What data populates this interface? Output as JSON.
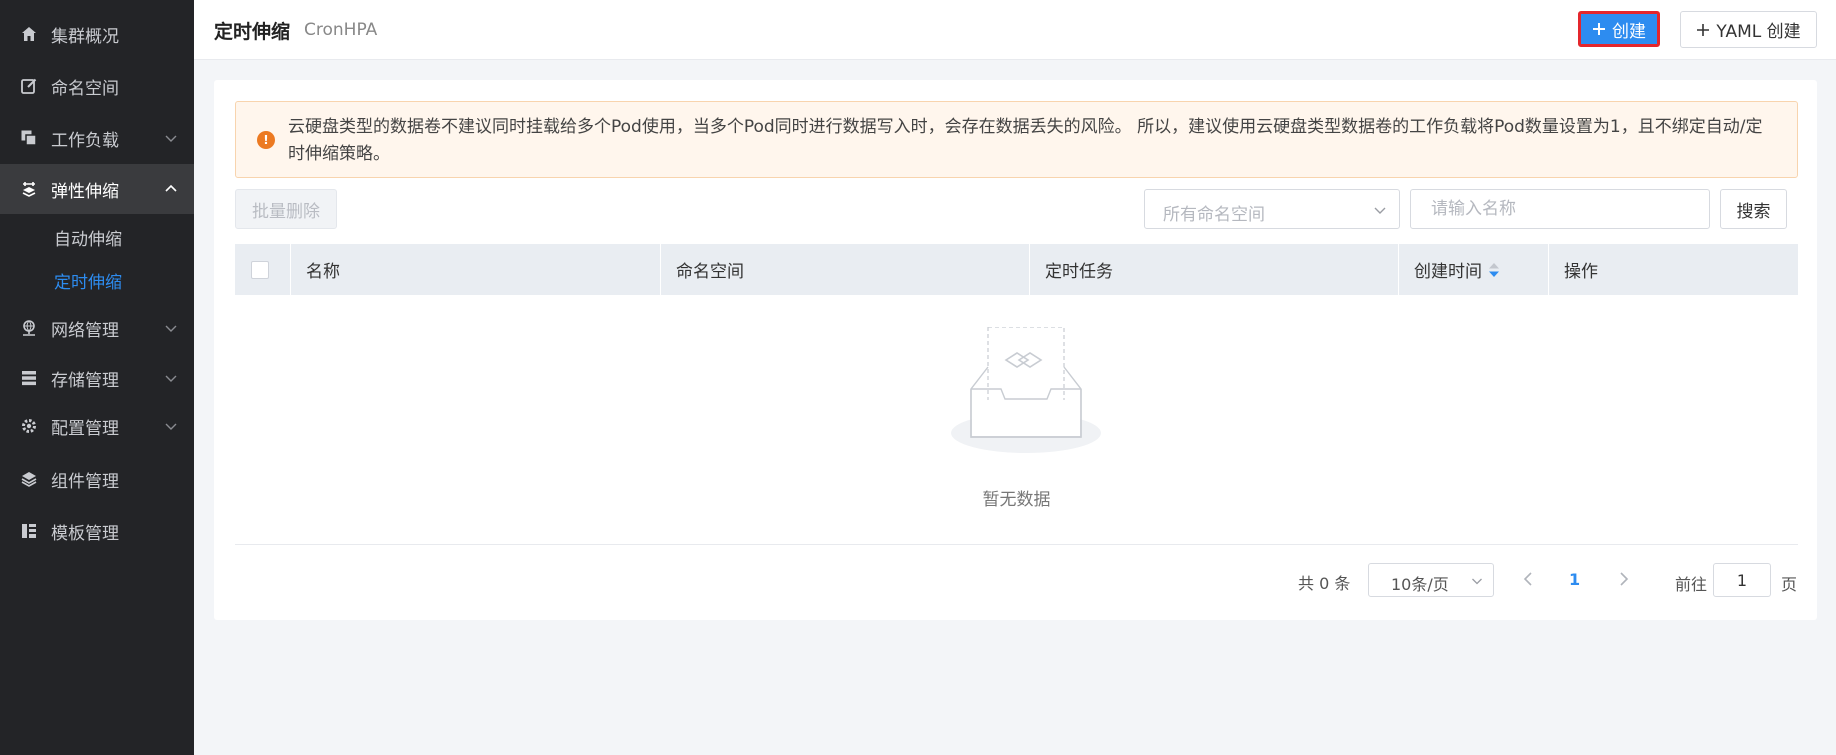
{
  "sidebar": {
    "items": [
      {
        "label": "集群概况",
        "icon": "home-icon"
      },
      {
        "label": "命名空间",
        "icon": "edit-icon"
      },
      {
        "label": "工作负载",
        "icon": "copy-icon"
      },
      {
        "label": "弹性伸缩",
        "icon": "scale-icon"
      },
      {
        "label": "网络管理",
        "icon": "network-icon"
      },
      {
        "label": "存储管理",
        "icon": "storage-icon"
      },
      {
        "label": "配置管理",
        "icon": "gear-icon"
      },
      {
        "label": "组件管理",
        "icon": "layers-icon"
      },
      {
        "label": "模板管理",
        "icon": "template-icon"
      }
    ],
    "sub_items": [
      {
        "label": "自动伸缩"
      },
      {
        "label": "定时伸缩"
      }
    ]
  },
  "header": {
    "title": "定时伸缩",
    "subtitle": "CronHPA",
    "create_label": "创建",
    "yaml_create_label": "YAML 创建"
  },
  "alert": {
    "text": "云硬盘类型的数据卷不建议同时挂载给多个Pod使用，当多个Pod同时进行数据写入时，会存在数据丢失的风险。 所以，建议使用云硬盘类型数据卷的工作负载将Pod数量设置为1，且不绑定自动/定时伸缩策略。"
  },
  "toolbar": {
    "batch_delete_label": "批量删除",
    "namespace_placeholder": "所有命名空间",
    "search_placeholder": "请输入名称",
    "search_label": "搜索"
  },
  "table": {
    "columns": [
      "名称",
      "命名空间",
      "定时任务",
      "创建时间",
      "操作"
    ],
    "rows": [],
    "empty_text": "暂无数据"
  },
  "pagination": {
    "total_text": "共 0 条",
    "page_size": "10条/页",
    "current_page": "1",
    "goto_label": "前往",
    "goto_value": "1",
    "page_suffix": "页"
  },
  "colors": {
    "accent": "#2d8cf0",
    "sidebar_bg": "#232427",
    "alert_bg": "#fff6ed",
    "alert_icon": "#ec7a22",
    "highlight_border": "#e4262c"
  }
}
